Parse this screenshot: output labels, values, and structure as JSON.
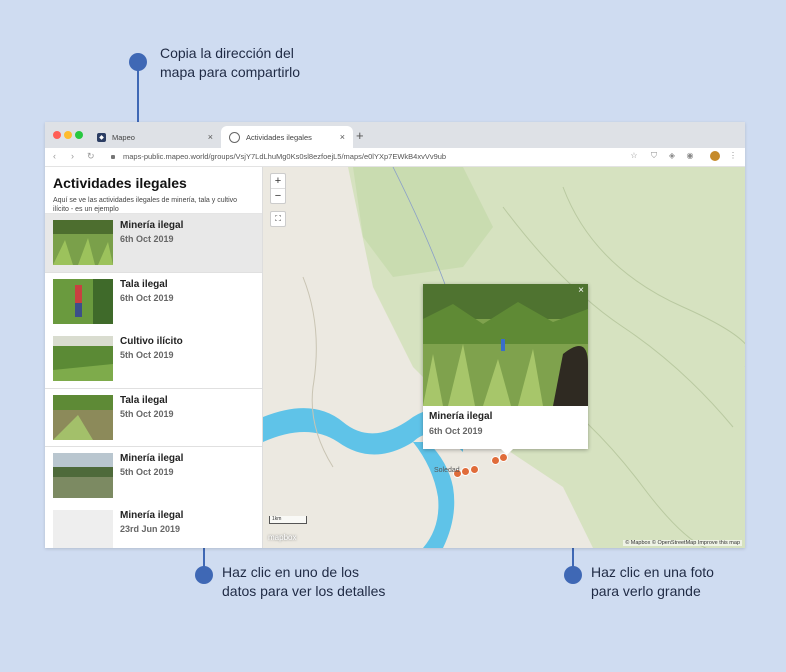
{
  "annotations": {
    "top": "Copia la dirección del\nmapa para compartirlo",
    "bottom_left": "Haz clic en uno de los\ndatos para ver los detalles",
    "bottom_right": "Haz clic en una foto\npara verlo grande"
  },
  "browser": {
    "tabs": [
      {
        "label": "Mapeo",
        "close": "×"
      },
      {
        "label": "Actividades ilegales",
        "close": "×"
      }
    ],
    "new_tab": "+",
    "url": "maps-public.mapeo.world/groups/VsjY7LdLhuMg0Ks0sl8ezfoejL5/maps/e0lYXp7EWkB4xvVv9ub"
  },
  "sidebar": {
    "title": "Actividades ilegales",
    "description": "Aquí se ve las actividades ilegales de minería, tala y cultivo ilícito - es un ejemplo",
    "items": [
      {
        "title": "Minería ilegal",
        "date": "6th Oct 2019"
      },
      {
        "title": "Tala ilegal",
        "date": "6th Oct 2019"
      },
      {
        "title": "Cultivo ilícito",
        "date": "5th Oct 2019"
      },
      {
        "title": "Tala ilegal",
        "date": "5th Oct 2019"
      },
      {
        "title": "Minería ilegal",
        "date": "5th Oct 2019"
      },
      {
        "title": "Minería ilegal",
        "date": "23rd Jun 2019"
      }
    ]
  },
  "map": {
    "zoom_in": "+",
    "zoom_out": "−",
    "popup": {
      "title": "Minería ilegal",
      "date": "6th Oct 2019",
      "close": "×"
    },
    "place_label": "Soledad",
    "scale_label": "1km",
    "logo": "mapbox",
    "attribution": "© Mapbox © OpenStreetMap Improve this map"
  },
  "colors": {
    "background": "#cfdcf1",
    "accent": "#3f68b5",
    "marker": "#e06c3a",
    "river": "#5fc3e8"
  }
}
